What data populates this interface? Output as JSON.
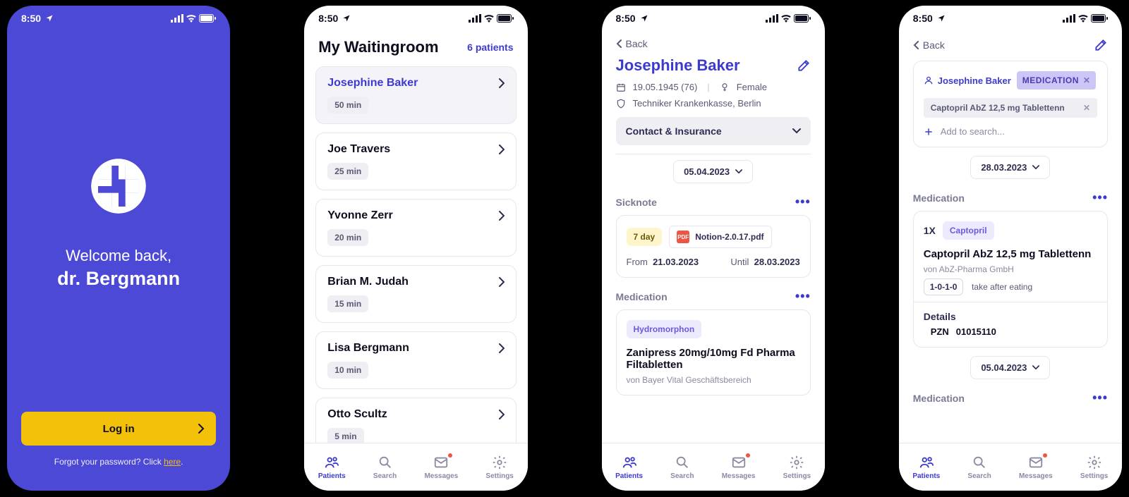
{
  "status": {
    "time": "8:50"
  },
  "login": {
    "welcome": "Welcome back,",
    "name": "dr. Bergmann",
    "button": "Log in",
    "forgot_prefix": "Forgot your password? Click ",
    "forgot_link": "here"
  },
  "waiting": {
    "title": "My Waitingroom",
    "count": "6 patients",
    "items": [
      {
        "name": "Josephine Baker",
        "wait": "50 min",
        "selected": true
      },
      {
        "name": "Joe Travers",
        "wait": "25 min"
      },
      {
        "name": "Yvonne Zerr",
        "wait": "20 min"
      },
      {
        "name": "Brian M. Judah",
        "wait": "15 min"
      },
      {
        "name": "Lisa Bergmann",
        "wait": "10 min"
      },
      {
        "name": "Otto Scultz",
        "wait": "5 min"
      }
    ]
  },
  "tabs": {
    "patients": "Patients",
    "search": "Search",
    "messages": "Messages",
    "settings": "Settings"
  },
  "patient": {
    "back": "Back",
    "name": "Josephine Baker",
    "dob": "19.05.1945 (76)",
    "gender": "Female",
    "insurance": "Techniker Krankenkasse, Berlin",
    "collapse": "Contact & Insurance",
    "date": "05.04.2023",
    "sicknote": {
      "title": "Sicknote",
      "badge": "7 day",
      "file": "Notion-2.0.17.pdf",
      "from_label": "From",
      "from": "21.03.2023",
      "until_label": "Until",
      "until": "28.03.2023"
    },
    "medication": {
      "title": "Medication",
      "drug_tag": "Hydromorphon",
      "drug_name": "Zanipress 20mg/10mg Fd Pharma Filtabletten",
      "drug_sub": "von Bayer Vital Geschäftsbereich"
    }
  },
  "med": {
    "back": "Back",
    "person": "Josephine Baker",
    "cat_chip": "MEDICATION",
    "drug_chip": "Captopril AbZ 12,5 mg Tablettenn",
    "add_search": "Add to search...",
    "date1": "28.03.2023",
    "section": "Medication",
    "qty": "1X",
    "tag": "Captopril",
    "name": "Captopril AbZ 12,5 mg Tablettenn",
    "maker": "von AbZ-Pharma GmbH",
    "dose": "1-0-1-0",
    "instr": "take after eating",
    "details_label": "Details",
    "pzn_label": "PZN",
    "pzn": "01015110",
    "date2": "05.04.2023",
    "section2": "Medication"
  }
}
